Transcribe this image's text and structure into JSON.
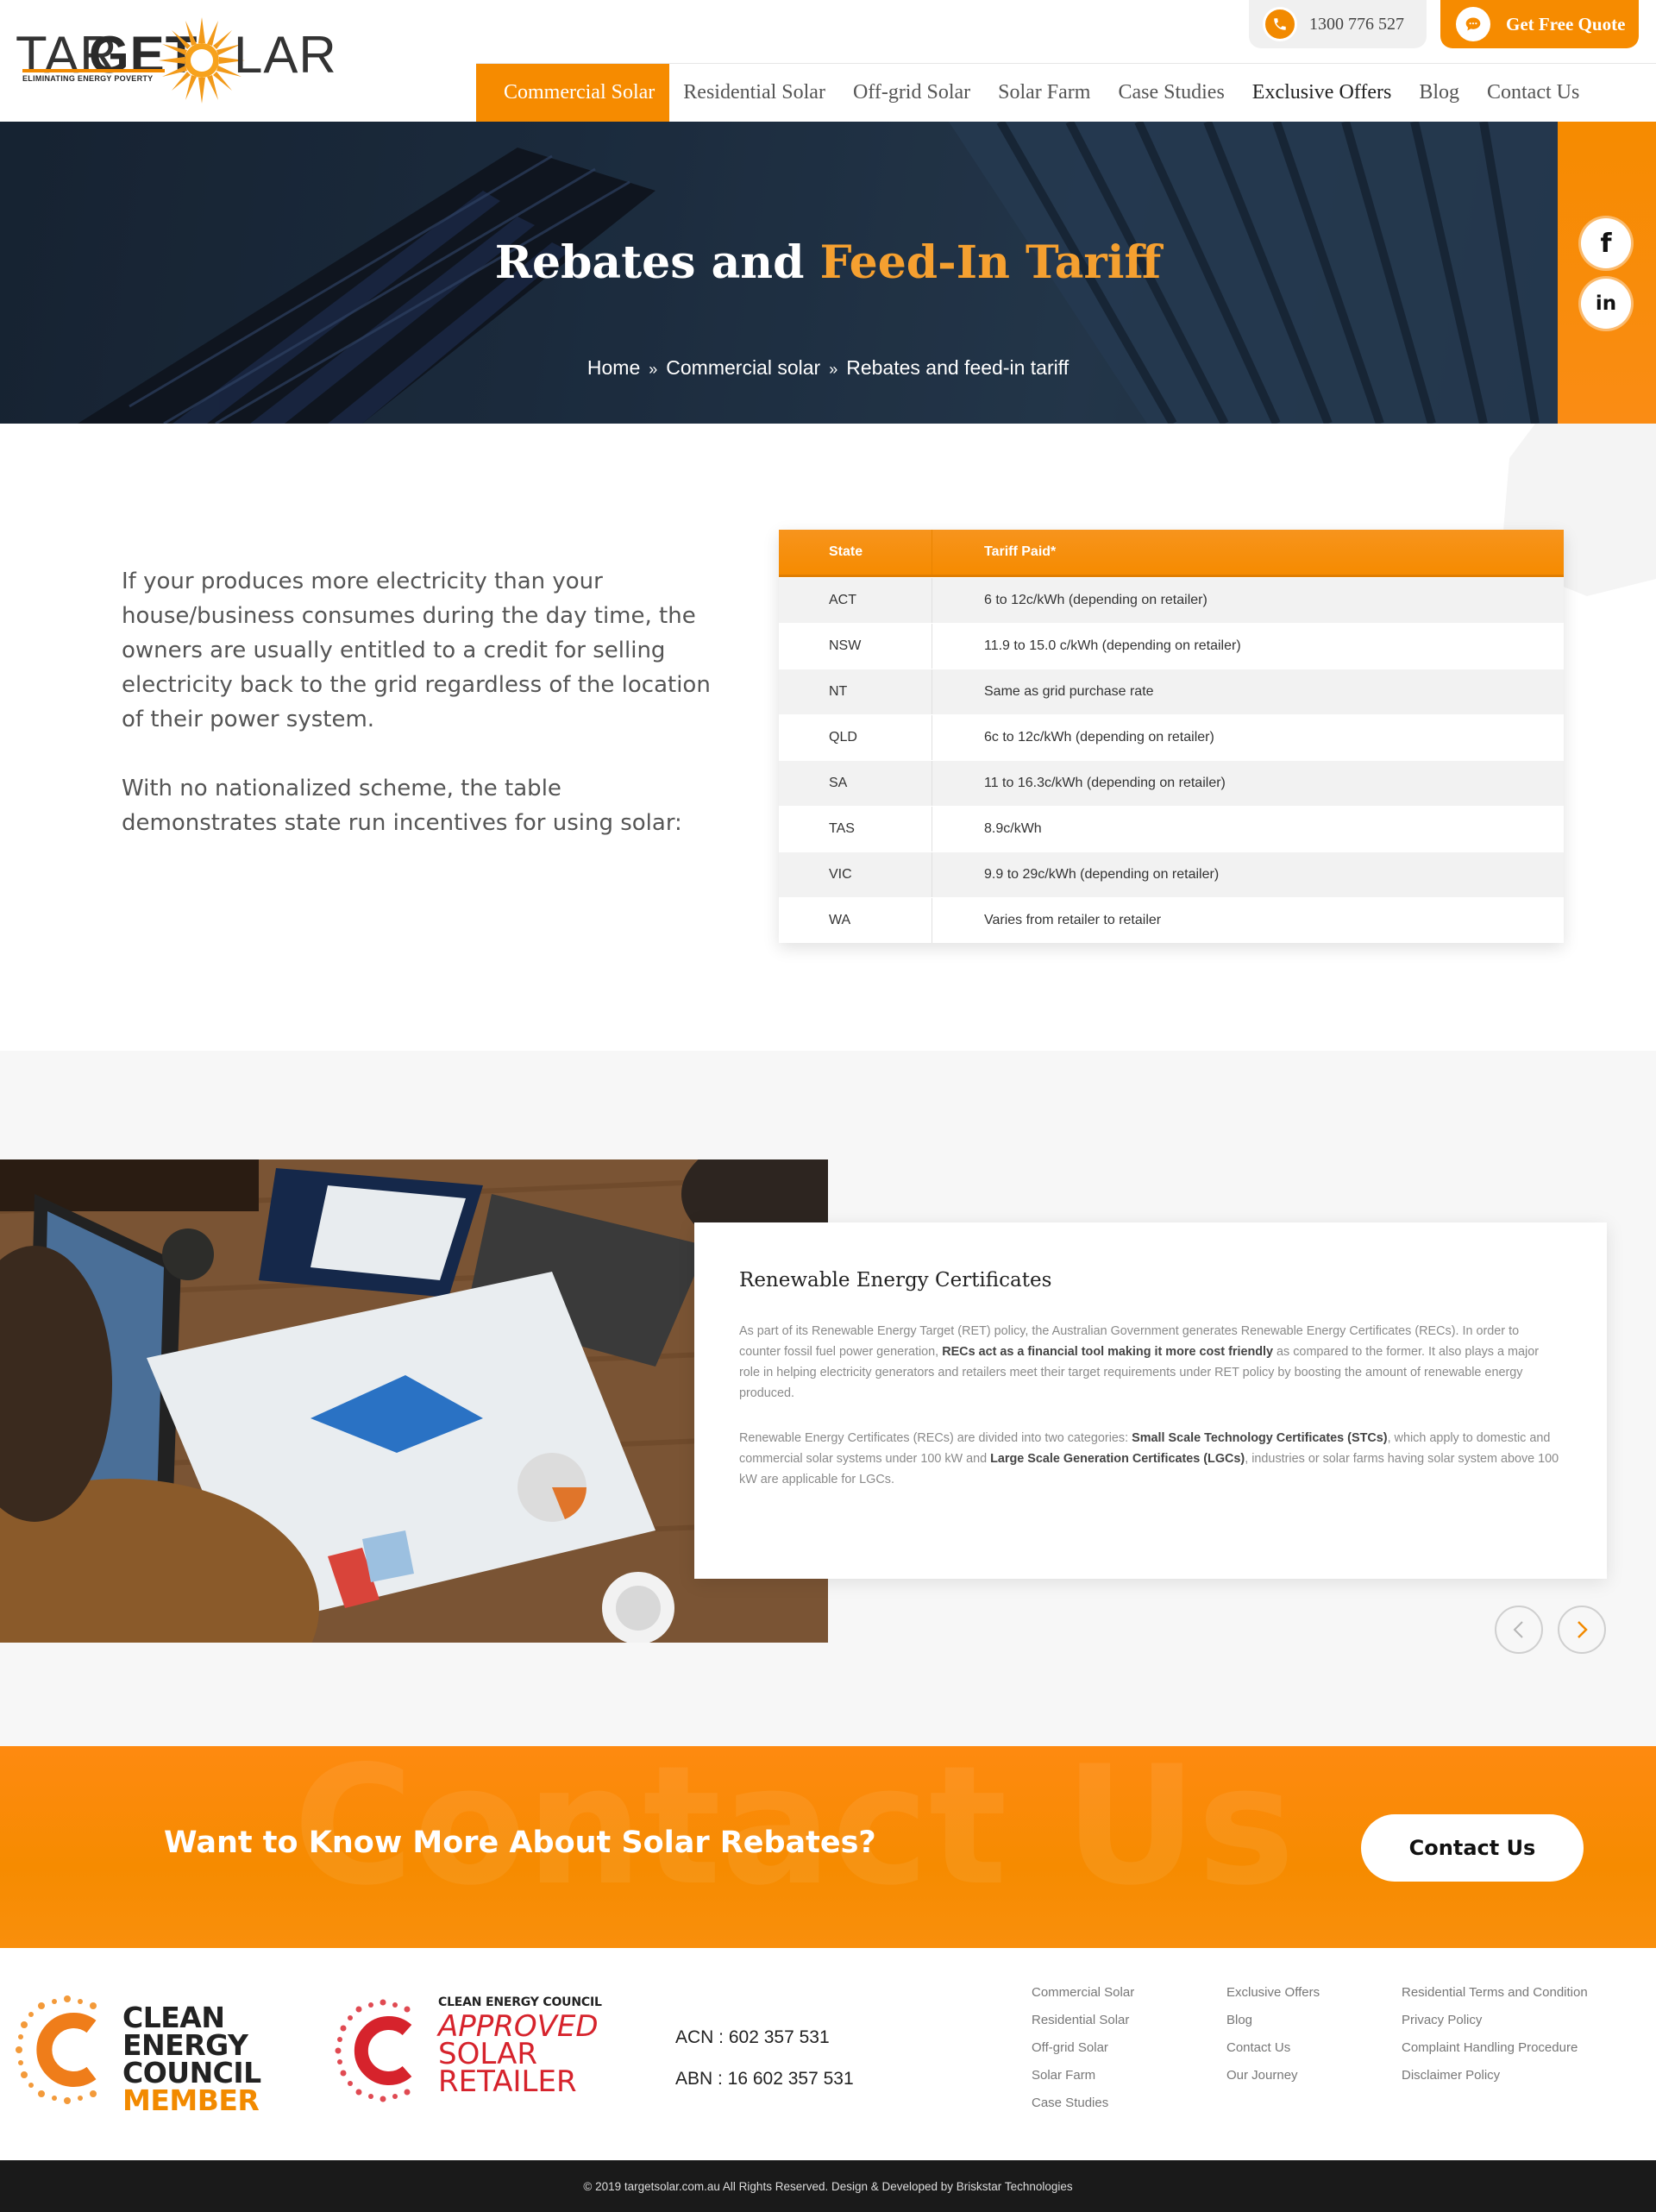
{
  "header": {
    "logo": {
      "word1": "TAR",
      "word2": "GET",
      "word3": "LAR",
      "tagline": "ELIMINATING ENERGY POVERTY"
    },
    "phone": "1300 776 527",
    "quote_button": "Get Free Quote",
    "nav": [
      {
        "label": "Commercial Solar"
      },
      {
        "label": "Residential Solar"
      },
      {
        "label": "Off-grid Solar"
      },
      {
        "label": "Solar Farm"
      },
      {
        "label": "Case Studies"
      },
      {
        "label": "Exclusive Offers"
      },
      {
        "label": "Blog"
      },
      {
        "label": "Contact Us"
      }
    ]
  },
  "hero": {
    "title_part1": "Rebates and ",
    "title_part2": "Feed-In Tariff",
    "breadcrumb": [
      "Home",
      "Commercial solar",
      "Rebates and feed-in tariff"
    ]
  },
  "social": [
    {
      "icon": "facebook-icon",
      "glyph": "f"
    },
    {
      "icon": "linkedin-icon",
      "glyph": "in"
    }
  ],
  "intro": {
    "p1": "If your produces more electricity than your house/business consumes during the day time, the owners are usually entitled to a credit for selling electricity back to the grid regardless of the location of their power system.",
    "p2": "With no nationalized scheme, the table demonstrates state run incentives for using solar:"
  },
  "tariff_table": {
    "headers": [
      "State",
      "Tariff Paid*"
    ],
    "rows": [
      [
        "ACT",
        "6 to 12c/kWh (depending on retailer)"
      ],
      [
        "NSW",
        "11.9 to 15.0 c/kWh (depending on retailer)"
      ],
      [
        "NT",
        "Same as grid purchase rate"
      ],
      [
        "QLD",
        "6c to 12c/kWh (depending on retailer)"
      ],
      [
        "SA",
        "11 to 16.3c/kWh (depending on retailer)"
      ],
      [
        "TAS",
        "8.9c/kWh"
      ],
      [
        "VIC",
        "9.9 to 29c/kWh (depending on retailer)"
      ],
      [
        "WA",
        "Varies from retailer to retailer"
      ]
    ]
  },
  "recs": {
    "title": "Renewable Energy Certificates",
    "p1_a": "As part of its Renewable Energy Target (RET) policy, the Australian Government generates Renewable Energy Certificates (RECs). In order to counter fossil fuel power generation, ",
    "p1_b": "RECs act as a financial tool making it more cost friendly",
    "p1_c": " as compared to the former. It also plays a major role in helping electricity generators and retailers meet their target requirements under RET policy by boosting the amount of renewable energy produced.",
    "p2_a": "Renewable Energy Certificates (RECs) are divided into two categories: ",
    "p2_b": "Small Scale Technology Certificates (STCs)",
    "p2_c": ", which apply to domestic and commercial solar systems under 100 kW and ",
    "p2_d": "Large Scale Generation Certificates (LGCs)",
    "p2_e": ", industries or solar farms having solar system above 100 kW are applicable for LGCs."
  },
  "cta": {
    "ghost_text": "Contact Us",
    "heading": "Want to Know More About Solar Rebates?",
    "button": "Contact Us"
  },
  "footer": {
    "cec_lines": [
      "CLEAN",
      "ENERGY",
      "COUNCIL",
      "MEMBER"
    ],
    "asr_lines": [
      "CLEAN ENERGY COUNCIL",
      "APPROVED",
      "SOLAR",
      "RETAILER"
    ],
    "acn": "ACN : 602 357 531",
    "abn": "ABN : 16 602 357 531",
    "col1": [
      "Commercial Solar",
      "Residential Solar",
      "Off-grid Solar",
      "Solar Farm",
      "Case Studies"
    ],
    "col2": [
      "Exclusive Offers",
      "Blog",
      "Contact Us",
      "Our Journey"
    ],
    "col3": [
      "Residential Terms and Condition",
      "Privacy Policy",
      "Complaint Handling Procedure",
      "Disclaimer Policy"
    ],
    "copyright": "© 2019 targetsolar.com.au All Rights Reserved. Design & Developed by Briskstar Technologies"
  },
  "colors": {
    "accent": "#f68b00",
    "hero_bg": "#1f3044",
    "footer_bar": "#1a1a1a",
    "cec_red": "#d6232c"
  }
}
